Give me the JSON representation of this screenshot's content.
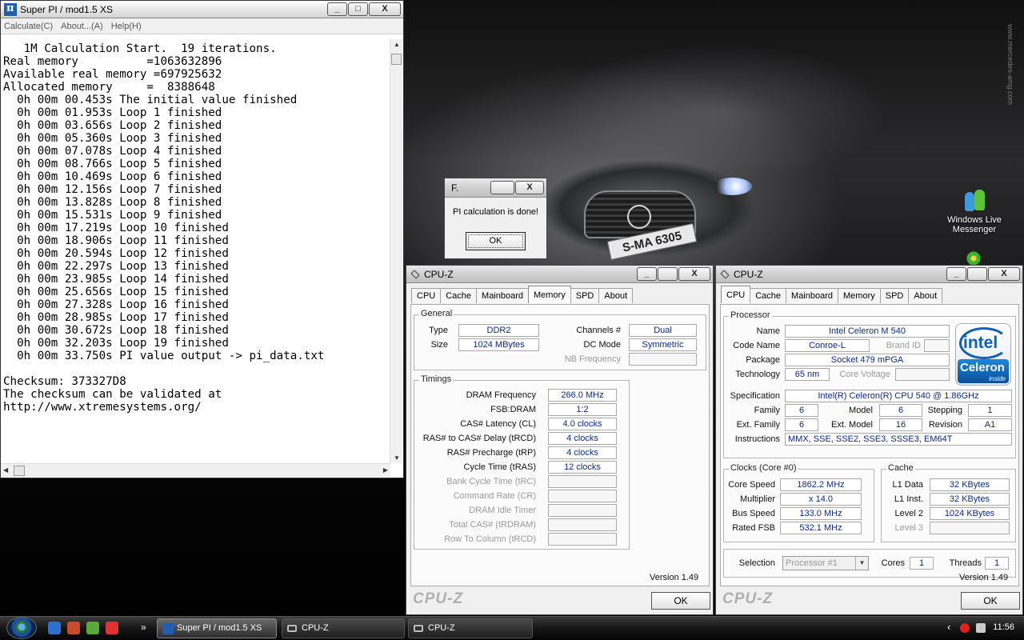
{
  "wallpaper": {
    "plate": "S-MA 6305",
    "watermark": "www.mercedes-amg.com"
  },
  "desktop_icons": [
    {
      "label": "Windows Live Messenger"
    }
  ],
  "superpi": {
    "title": "Super PI / mod1.5 XS",
    "menu": [
      "Calculate(C)",
      "About...(A)",
      "Help(H)"
    ],
    "output": [
      "   1M Calculation Start.  19 iterations.",
      "Real memory          =1063632896",
      "Available real memory =697925632",
      "Allocated memory     =  8388648",
      "  0h 00m 00.453s The initial value finished",
      "  0h 00m 01.953s Loop 1 finished",
      "  0h 00m 03.656s Loop 2 finished",
      "  0h 00m 05.360s Loop 3 finished",
      "  0h 00m 07.078s Loop 4 finished",
      "  0h 00m 08.766s Loop 5 finished",
      "  0h 00m 10.469s Loop 6 finished",
      "  0h 00m 12.156s Loop 7 finished",
      "  0h 00m 13.828s Loop 8 finished",
      "  0h 00m 15.531s Loop 9 finished",
      "  0h 00m 17.219s Loop 10 finished",
      "  0h 00m 18.906s Loop 11 finished",
      "  0h 00m 20.594s Loop 12 finished",
      "  0h 00m 22.297s Loop 13 finished",
      "  0h 00m 23.985s Loop 14 finished",
      "  0h 00m 25.656s Loop 15 finished",
      "  0h 00m 27.328s Loop 16 finished",
      "  0h 00m 28.985s Loop 17 finished",
      "  0h 00m 30.672s Loop 18 finished",
      "  0h 00m 32.203s Loop 19 finished",
      "  0h 00m 33.750s PI value output -> pi_data.txt",
      "",
      "Checksum: 373327D8",
      "The checksum can be validated at",
      "http://www.xtremesystems.org/"
    ]
  },
  "dialog": {
    "title": "F.",
    "message": "PI calculation is done!",
    "ok_label": "OK"
  },
  "cpuz_memory": {
    "title": "CPU-Z",
    "tabs": [
      "CPU",
      "Cache",
      "Mainboard",
      "Memory",
      "SPD",
      "About"
    ],
    "active_tab": "Memory",
    "general_title": "General",
    "type_label": "Type",
    "type_value": "DDR2",
    "size_label": "Size",
    "size_value": "1024 MBytes",
    "channels_label": "Channels #",
    "channels_value": "Dual",
    "dcmode_label": "DC Mode",
    "dcmode_value": "Symmetric",
    "nbfreq_label": "NB Frequency",
    "nbfreq_value": "",
    "timings_title": "Timings",
    "timings": [
      {
        "label": "DRAM Frequency",
        "value": "266.0 MHz",
        "dim": false
      },
      {
        "label": "FSB:DRAM",
        "value": "1:2",
        "dim": false
      },
      {
        "label": "CAS# Latency (CL)",
        "value": "4.0 clocks",
        "dim": false
      },
      {
        "label": "RAS# to CAS# Delay (tRCD)",
        "value": "4 clocks",
        "dim": false
      },
      {
        "label": "RAS# Precharge (tRP)",
        "value": "4 clocks",
        "dim": false
      },
      {
        "label": "Cycle Time (tRAS)",
        "value": "12 clocks",
        "dim": false
      },
      {
        "label": "Bank Cycle Time (tRC)",
        "value": "",
        "dim": true
      },
      {
        "label": "Command Rate (CR)",
        "value": "",
        "dim": true
      },
      {
        "label": "DRAM Idle Timer",
        "value": "",
        "dim": true
      },
      {
        "label": "Total CAS# (tRDRAM)",
        "value": "",
        "dim": true
      },
      {
        "label": "Row To Column (tRCD)",
        "value": "",
        "dim": true
      }
    ],
    "version": "Version 1.49",
    "brand": "CPU-Z",
    "ok_label": "OK"
  },
  "cpuz_cpu": {
    "title": "CPU-Z",
    "tabs": [
      "CPU",
      "Cache",
      "Mainboard",
      "Memory",
      "SPD",
      "About"
    ],
    "active_tab": "CPU",
    "processor_title": "Processor",
    "name_label": "Name",
    "name_value": "Intel Celeron M 540",
    "codename_label": "Code Name",
    "codename_value": "Conroe-L",
    "brandid_label": "Brand ID",
    "brandid_value": "",
    "package_label": "Package",
    "package_value": "Socket 479 mPGA",
    "technology_label": "Technology",
    "technology_value": "65 nm",
    "corevoltage_label": "Core Voltage",
    "corevoltage_value": "",
    "spec_label": "Specification",
    "spec_value": "Intel(R) Celeron(R) CPU        540  @ 1.86GHz",
    "family_label": "Family",
    "family_value": "6",
    "model_label": "Model",
    "model_value": "6",
    "stepping_label": "Stepping",
    "stepping_value": "1",
    "extfamily_label": "Ext. Family",
    "extfamily_value": "6",
    "extmodel_label": "Ext. Model",
    "extmodel_value": "16",
    "revision_label": "Revision",
    "revision_value": "A1",
    "instructions_label": "Instructions",
    "instructions_value": "MMX, SSE, SSE2, SSE3, SSSE3, EM64T",
    "logo_word": "intel",
    "logo_sub": "Celeron",
    "logo_inside": "inside",
    "clocks_title": "Clocks (Core #0)",
    "corespeed_label": "Core Speed",
    "corespeed_value": "1862.2 MHz",
    "multiplier_label": "Multiplier",
    "multiplier_value": "x 14.0",
    "busspeed_label": "Bus Speed",
    "busspeed_value": "133.0 MHz",
    "ratedfsb_label": "Rated FSB",
    "ratedfsb_value": "532.1 MHz",
    "cache_title": "Cache",
    "l1d_label": "L1 Data",
    "l1d_value": "32 KBytes",
    "l1i_label": "L1 Inst.",
    "l1i_value": "32 KBytes",
    "l2_label": "Level 2",
    "l2_value": "1024 KBytes",
    "l3_label": "Level 3",
    "l3_value": "",
    "selection_label": "Selection",
    "selection_value": "Processor #1",
    "cores_label": "Cores",
    "cores_value": "1",
    "threads_label": "Threads",
    "threads_value": "1",
    "version": "Version 1.49",
    "brand": "CPU-Z",
    "ok_label": "OK"
  },
  "taskbar": {
    "tasks": [
      {
        "label": "Super PI / mod1.5 XS"
      },
      {
        "label": "CPU-Z"
      },
      {
        "label": "CPU-Z"
      }
    ],
    "more_label": "»",
    "tray_collapse": "‹",
    "clock": "11:56"
  },
  "caption_glyphs": {
    "minimize": "_",
    "maximize": "□",
    "close": "X",
    "up": "▲",
    "down": "▼",
    "left": "◀",
    "right": "▶"
  }
}
